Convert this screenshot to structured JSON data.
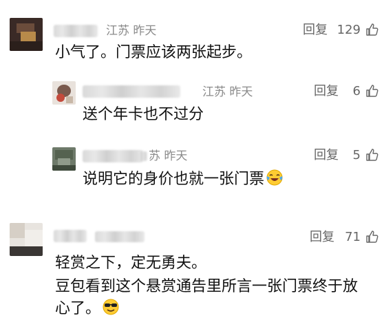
{
  "comments": [
    {
      "location_time": "江苏  昨天",
      "reply_label": "回复",
      "likes": "129",
      "content": "小气了。门票应该两张起步。"
    },
    {
      "location_time": "江苏  昨天",
      "reply_label": "回复",
      "likes": "6",
      "content": "送个年卡也不过分"
    },
    {
      "location_time": "苏  昨天",
      "reply_label": "回复",
      "likes": "5",
      "content": "说明它的身价也就一张门票"
    },
    {
      "reply_label": "回复",
      "likes": "71",
      "content_line1": "轻赏之下，定无勇夫。",
      "content_line2": "豆包看到这个悬赏通告里所言一张门票终于放",
      "content_line3": "心了。"
    }
  ],
  "icons": {
    "like": "thumbs-up-icon",
    "laugh_emoji": "laughing-tears-emoji",
    "cool_emoji": "sunglasses-emoji"
  },
  "colors": {
    "meta_gray": "#8a8a8a",
    "action_gray": "#666666",
    "text": "#111111"
  }
}
